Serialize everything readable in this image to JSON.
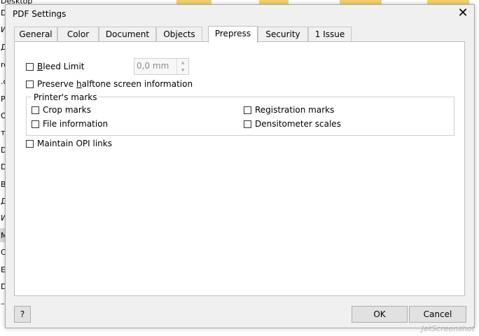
{
  "background": {
    "desktop_label": "Desktop",
    "left_items": [
      "D",
      "И",
      "Д",
      "re",
      ".c",
      "P",
      "Or",
      "то",
      "D",
      "D",
      "B",
      "Д",
      "И",
      "M",
      "C",
      "E",
      "D",
      "–"
    ]
  },
  "dialog": {
    "title": "PDF Settings",
    "close_glyph": "✕"
  },
  "tabs": [
    {
      "label": "General",
      "active": false
    },
    {
      "label": "Color",
      "active": false
    },
    {
      "label": "Document",
      "active": false
    },
    {
      "label": "Objects",
      "active": false
    },
    {
      "label": "Prepress",
      "active": true
    },
    {
      "label": "Security",
      "active": false
    },
    {
      "label": "1 Issue",
      "active": false
    }
  ],
  "prepress": {
    "bleed_limit": {
      "label": "Bleed Limit",
      "mnemonic": "B",
      "checked": false
    },
    "bleed_value": "0,0 mm",
    "preserve_halftone": {
      "label": "Preserve halftone screen information",
      "mnemonic": "h",
      "checked": false
    },
    "printers_marks": {
      "title": "Printer's marks",
      "crop_marks": {
        "label": "Crop marks",
        "checked": false
      },
      "file_information": {
        "label": "File information",
        "checked": false
      },
      "registration_marks": {
        "label": "Registration marks",
        "checked": false
      },
      "densitometer_scales": {
        "label": "Densitometer scales",
        "checked": false
      }
    },
    "maintain_opi": {
      "label": "Maintain OPI links",
      "checked": false
    }
  },
  "buttons": {
    "help": "?",
    "ok": "OK",
    "cancel": "Cancel"
  },
  "watermark": "JetScreenshot",
  "colors": {
    "dialog_bg": "#f0f0f0",
    "panel_bg": "#ffffff",
    "button_bg": "#e1e1e1",
    "border": "#adadad"
  }
}
